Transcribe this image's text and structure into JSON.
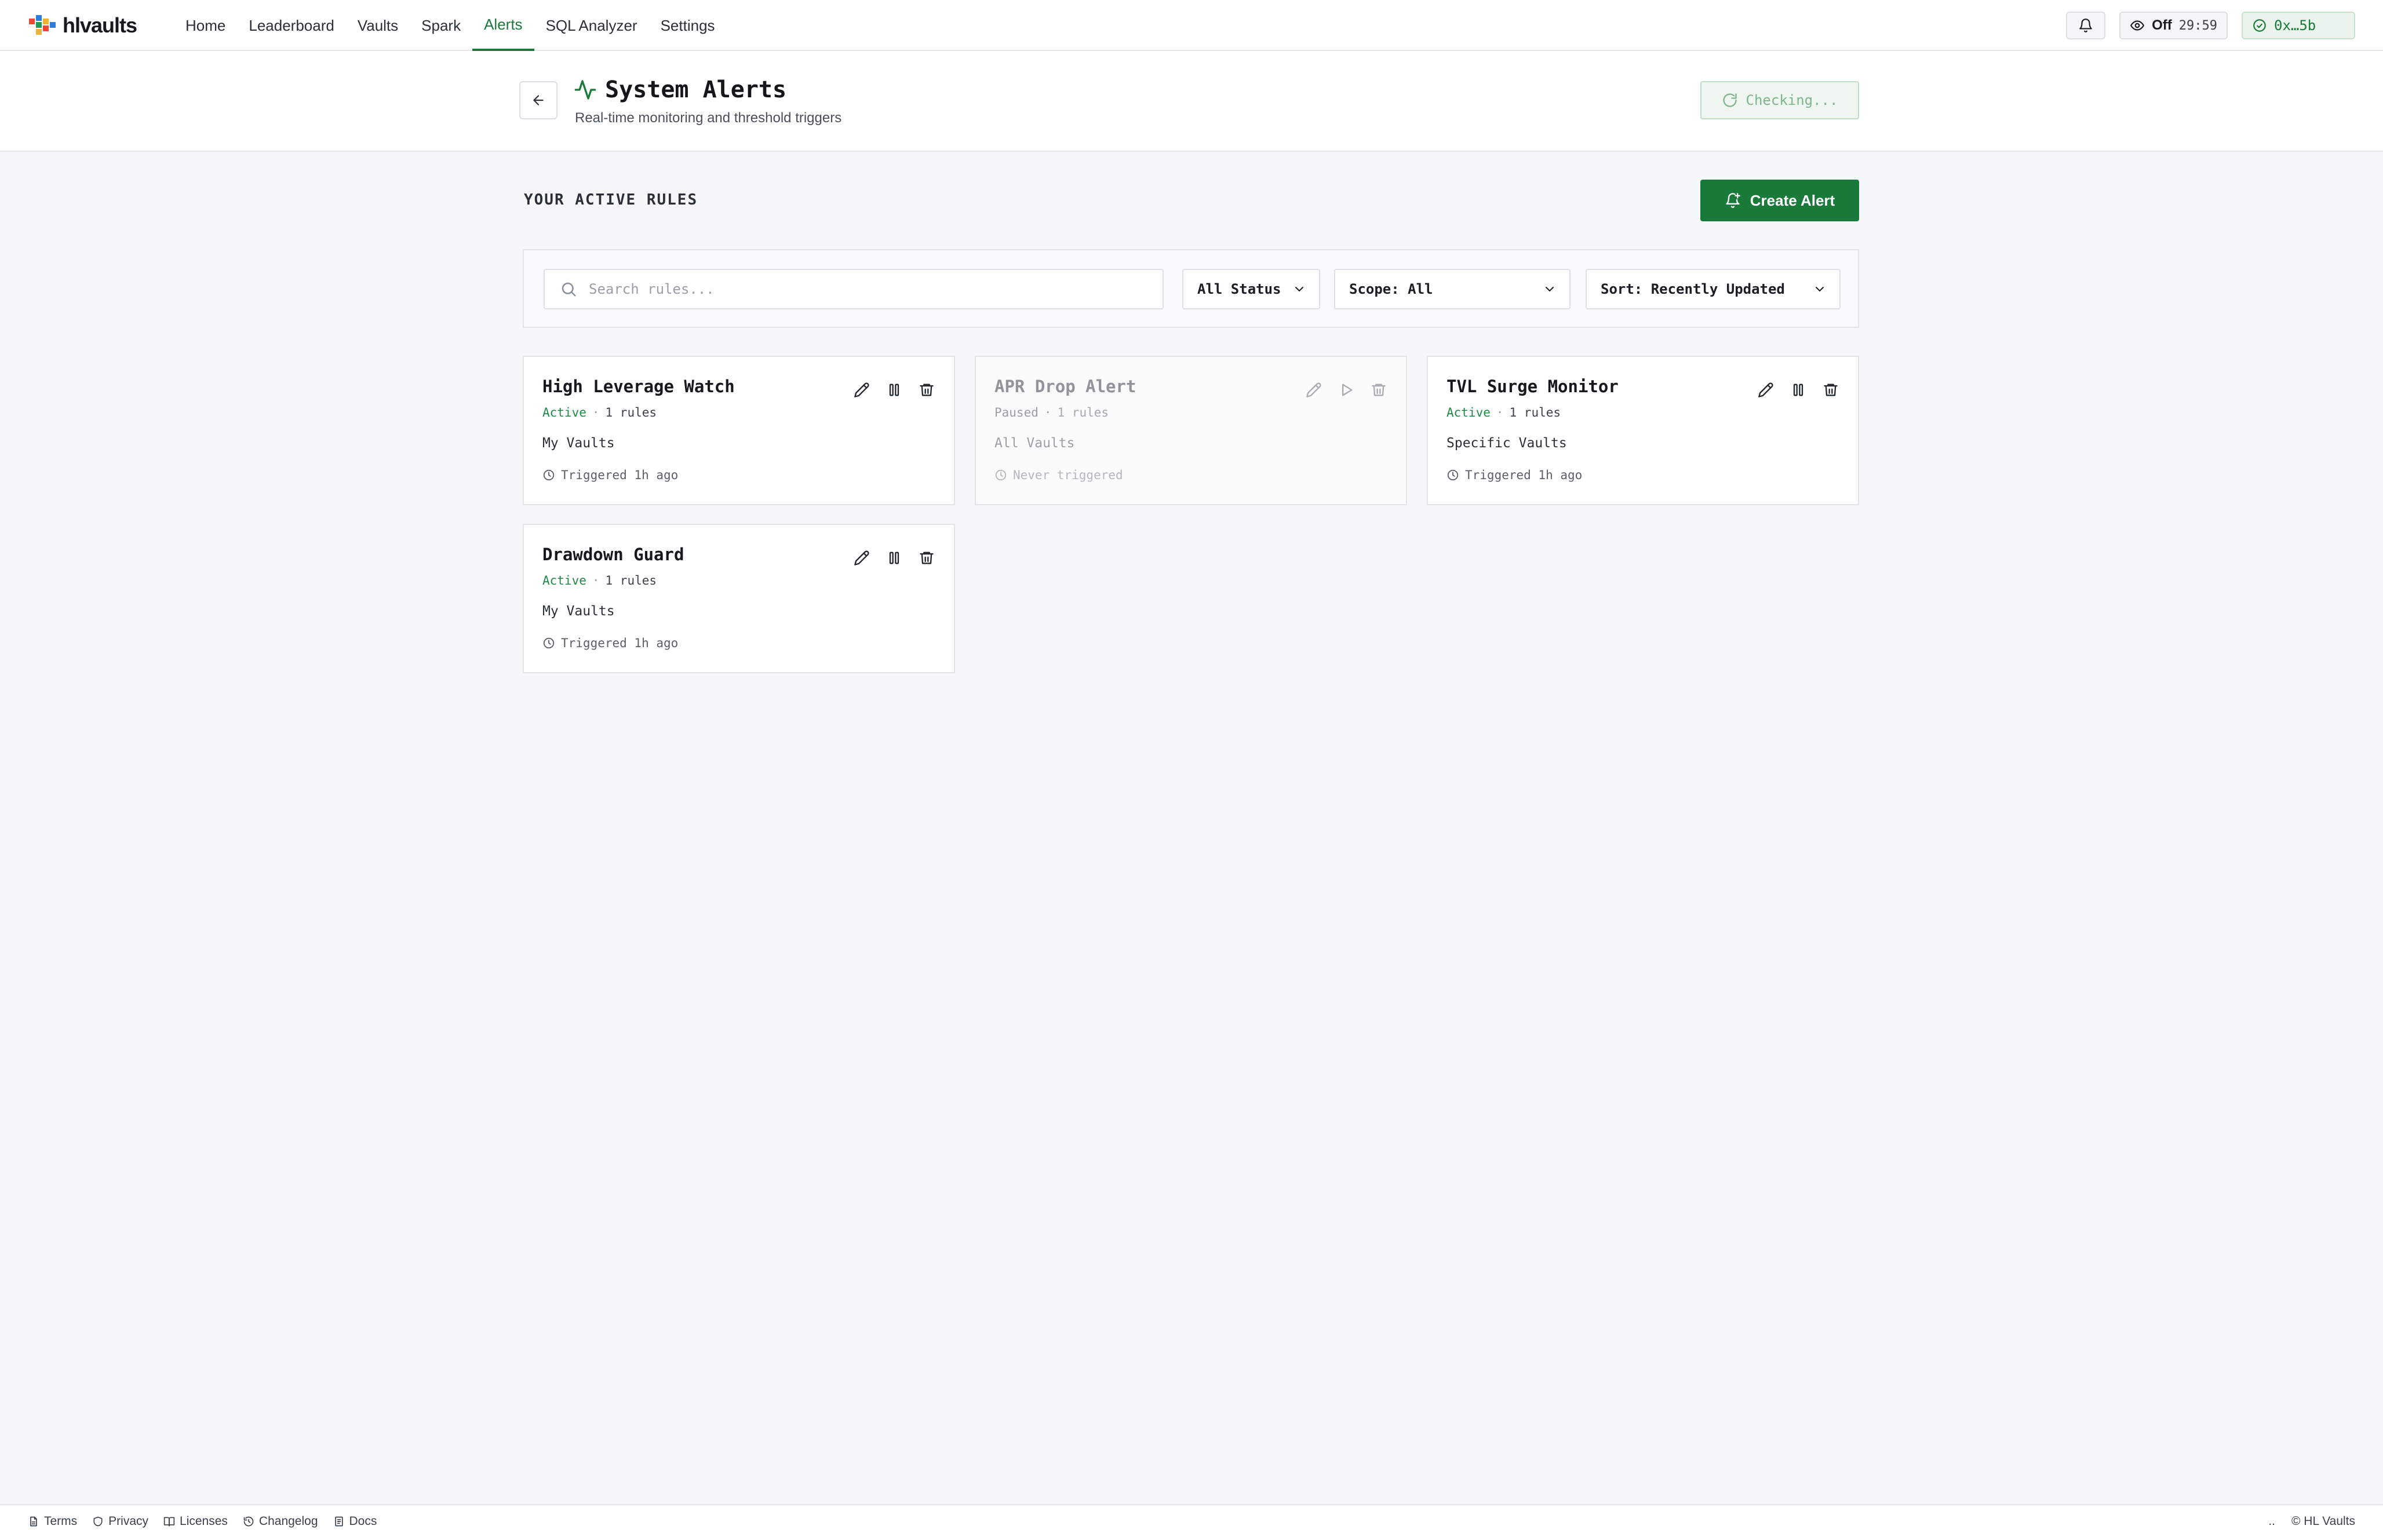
{
  "brand": {
    "name": "hlvaults"
  },
  "nav": {
    "links": [
      "Home",
      "Leaderboard",
      "Vaults",
      "Spark",
      "Alerts",
      "SQL Analyzer",
      "Settings"
    ],
    "active": "Alerts",
    "watch_label": "Off",
    "timer": "29:59",
    "wallet": "0x…5b"
  },
  "header": {
    "title": "System Alerts",
    "subtitle": "Real-time monitoring and threshold triggers",
    "checking_label": "Checking..."
  },
  "main": {
    "section_title": "YOUR ACTIVE RULES",
    "create_label": "Create Alert",
    "search_placeholder": "Search rules...",
    "status_filter": "All Status",
    "scope_filter": "Scope: All",
    "sort_filter": "Sort: Recently Updated"
  },
  "alerts": [
    {
      "name": "High Leverage Watch",
      "status": "Active",
      "rules": "1 rules",
      "scope": "My Vaults",
      "triggered": "Triggered 1h ago"
    },
    {
      "name": "APR Drop Alert",
      "status": "Paused",
      "rules": "1 rules",
      "scope": "All Vaults",
      "triggered": "Never triggered"
    },
    {
      "name": "TVL Surge Monitor",
      "status": "Active",
      "rules": "1 rules",
      "scope": "Specific Vaults",
      "triggered": "Triggered 1h ago"
    },
    {
      "name": "Drawdown Guard",
      "status": "Active",
      "rules": "1 rules",
      "scope": "My Vaults",
      "triggered": "Triggered 1h ago"
    }
  ],
  "footer": {
    "links": [
      "Terms",
      "Privacy",
      "Licenses",
      "Changelog",
      "Docs"
    ],
    "ellipsis": "..",
    "copyright": "© HL Vaults"
  },
  "colors": {
    "accent": "#197a3a",
    "active_status": "#1e8a45",
    "background": "#f6f7f8"
  },
  "icons": [
    "bell-icon",
    "eye-icon",
    "check-circle-icon",
    "arrow-left-icon",
    "activity-icon",
    "refresh-icon",
    "bell-plus-icon",
    "search-icon",
    "chevron-down-icon",
    "pencil-icon",
    "pause-icon",
    "play-icon",
    "trash-icon",
    "clock-icon"
  ]
}
